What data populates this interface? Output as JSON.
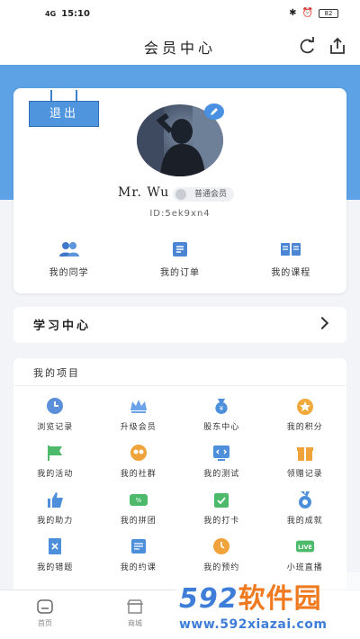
{
  "status_bar": {
    "network": "4G",
    "time": "15:10",
    "battery": "82"
  },
  "header": {
    "title": "会员中心"
  },
  "profile": {
    "logout_label": "退出",
    "username": "Mr. Wu",
    "member_level": "普通会员",
    "user_id": "ID:5ek9xn4"
  },
  "quick_links": [
    {
      "label": "我的同学",
      "icon": "classmates-icon"
    },
    {
      "label": "我的订单",
      "icon": "orders-icon"
    },
    {
      "label": "我的课程",
      "icon": "courses-icon"
    }
  ],
  "learning_center": {
    "label": "学习中心"
  },
  "projects": {
    "title": "我的项目",
    "items": [
      {
        "label": "浏览记录",
        "icon": "clock-icon",
        "color": "#5b8fd9"
      },
      {
        "label": "升级会员",
        "icon": "crown-icon",
        "color": "#6aa3e8"
      },
      {
        "label": "股东中心",
        "icon": "money-bag-icon",
        "color": "#4e8fdc"
      },
      {
        "label": "我的积分",
        "icon": "points-icon",
        "color": "#f2a93b"
      },
      {
        "label": "我的活动",
        "icon": "flag-icon",
        "color": "#4cba6a"
      },
      {
        "label": "我的社群",
        "icon": "community-icon",
        "color": "#f0a33a"
      },
      {
        "label": "我的测试",
        "icon": "code-test-icon",
        "color": "#4e8fdc"
      },
      {
        "label": "领赠记录",
        "icon": "gift-icon",
        "color": "#f0a33a"
      },
      {
        "label": "我的助力",
        "icon": "thumbs-up-icon",
        "color": "#4e8fdc"
      },
      {
        "label": "我的拼团",
        "icon": "group-buy-icon",
        "color": "#4cba6a"
      },
      {
        "label": "我的打卡",
        "icon": "check-in-icon",
        "color": "#4cba6a"
      },
      {
        "label": "我的成就",
        "icon": "medal-icon",
        "color": "#4e8fdc"
      },
      {
        "label": "我的错题",
        "icon": "wrong-answers-icon",
        "color": "#4e8fdc"
      },
      {
        "label": "我的约课",
        "icon": "booking-icon",
        "color": "#4e8fdc"
      },
      {
        "label": "我的预约",
        "icon": "appointment-icon",
        "color": "#f0a33a"
      },
      {
        "label": "小班直播",
        "icon": "live-icon",
        "color": "#4cba6a",
        "badge": "LIVE"
      }
    ]
  },
  "bottom_nav": [
    {
      "label": "首页",
      "icon": "home-icon"
    },
    {
      "label": "商城",
      "icon": "shop-icon"
    },
    {
      "label": "",
      "icon": ""
    },
    {
      "label": "",
      "icon": ""
    }
  ],
  "watermark": {
    "brand_num": "592",
    "brand_text": "软件园",
    "url": "www.592xiazai.com"
  },
  "colors": {
    "primary": "#5ea2e6",
    "accent_orange": "#f0a33a",
    "accent_green": "#4cba6a"
  }
}
